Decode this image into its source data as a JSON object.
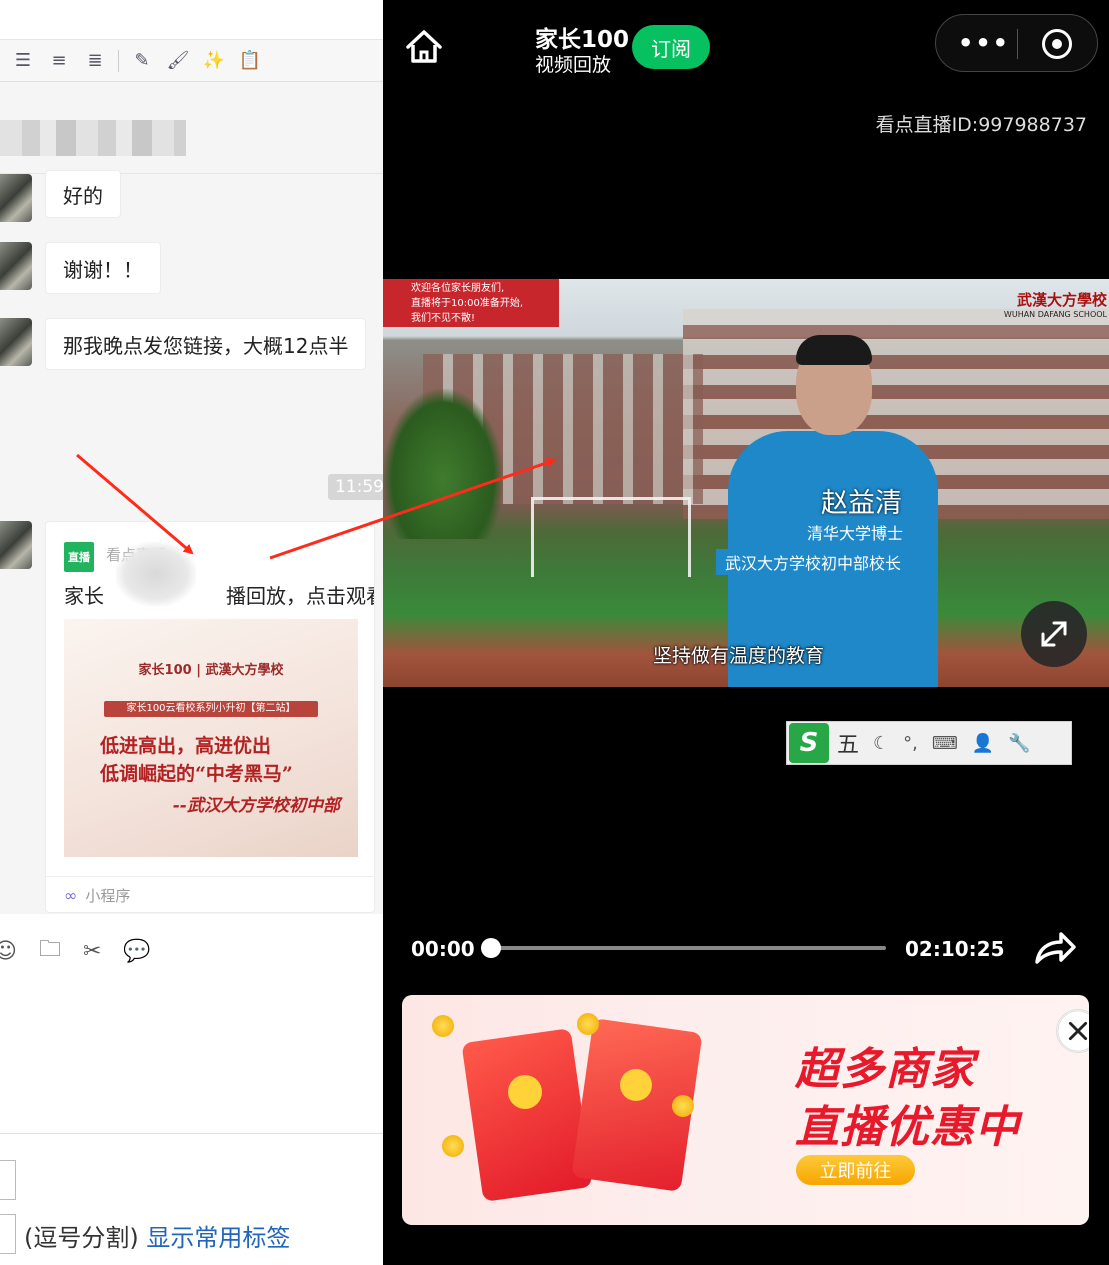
{
  "left_panel": {
    "messages": [
      {
        "text": "好的"
      },
      {
        "text": "谢谢！！"
      },
      {
        "text": "那我晚点发您链接，大概12点半"
      }
    ],
    "timestamp": "11:59",
    "mini_card": {
      "logo": "直播",
      "source": "看点直播",
      "title_prefix": "家长",
      "title_suffix": "播回放，点击观看",
      "cover": {
        "logos": "家长100  |  武漢大方學校",
        "tag": "家长100云看校系列小升初【第二站】",
        "line1": "低进高出，高进优出",
        "line2": "低调崛起的“中考黑马”",
        "line3": "--武汉大方学校初中部"
      },
      "footer": "小程序"
    },
    "tags": {
      "hint": "(逗号分割)",
      "link": "显示常用标签"
    }
  },
  "right_panel": {
    "app_title": "家长100",
    "app_subtitle": "视频回放",
    "subscribe_label": "订阅",
    "live_id": "看点直播ID:997988737",
    "video": {
      "notice": [
        "欢迎各位家长朋友们,",
        "直播将于10:00准备开始,",
        "我们不见不散!"
      ],
      "school_cn": "武漢大方學校",
      "school_en": "WUHAN DAFANG SCHOOL",
      "speaker_name": "赵益清",
      "speaker_title1": "清华大学博士",
      "speaker_title2": "武汉大方学校初中部校长",
      "subtitle": "坚持做有温度的教育"
    },
    "ime": {
      "logo": "S",
      "mode": "五"
    },
    "player": {
      "current_time": "00:00",
      "total_time": "02:10:25",
      "progress": 0.0
    },
    "ad": {
      "line1": "超多商家",
      "line2": "直播优惠中",
      "button": "立即前往"
    }
  },
  "colors": {
    "wechat_green": "#07c160",
    "ad_red": "#e8192a",
    "arrow_red": "#ff2a1a"
  },
  "icons": {
    "home": "home-icon",
    "more": "more-dots-icon",
    "close_app": "target-circle-icon",
    "fullscreen": "expand-icon",
    "share": "share-arrow-icon",
    "ad_close": "close-icon"
  }
}
